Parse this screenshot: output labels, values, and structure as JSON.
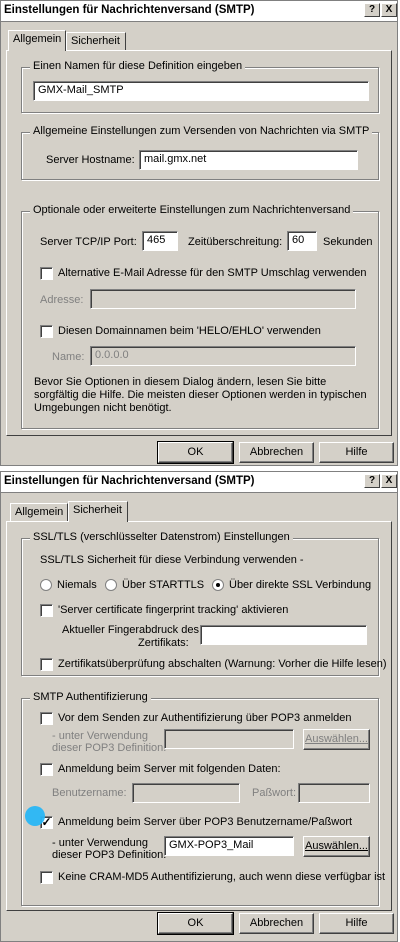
{
  "window_title": "Einstellungen für Nachrichtenversand (SMTP)",
  "title_buttons": {
    "help": "?",
    "close": "X"
  },
  "tabs": {
    "general": "Allgemein",
    "security": "Sicherheit"
  },
  "dialog1": {
    "group_name": {
      "legend": "Einen Namen für diese Definition eingeben",
      "value": "GMX-Mail_SMTP"
    },
    "group_general": {
      "legend": "Allgemeine Einstellungen zum Versenden von Nachrichten via SMTP",
      "host_label": "Server Hostname:",
      "host_value": "mail.gmx.net"
    },
    "group_optional": {
      "legend": "Optionale oder erweiterte Einstellungen zum Nachrichtenversand",
      "port_label": "Server TCP/IP Port:",
      "port_value": "465",
      "timeout_label": "Zeitüberschreitung:",
      "timeout_value": "60",
      "seconds_label": "Sekunden",
      "alt_address_label": "Alternative E-Mail Adresse für den SMTP Umschlag verwenden",
      "address_label": "Adresse:",
      "address_value": "",
      "domain_label": "Diesen Domainnamen beim 'HELO/EHLO' verwenden",
      "name_label": "Name:",
      "name_value": "0.0.0.0",
      "note": "Bevor Sie Optionen in diesem Dialog ändern, lesen Sie bitte sorgfältig die Hilfe. Die meisten dieser Optionen werden in typischen Umgebungen nicht benötigt."
    }
  },
  "dialog2": {
    "group_ssl": {
      "legend": "SSL/TLS (verschlüsselter Datenstrom) Einstellungen",
      "security_label": "SSL/TLS Sicherheit für diese Verbindung verwenden -",
      "radio_never": "Niemals",
      "radio_starttls": "Über STARTTLS",
      "radio_ssl": "Über direkte SSL Verbindung",
      "fingerprint_tracking": "'Server certificate fingerprint tracking' aktivieren",
      "fingerprint_label_1": "Aktueller Fingerabdruck des",
      "fingerprint_label_2": "Zertifikats:",
      "fingerprint_value": "",
      "cert_check_off": "Zertifikatsüberprüfung abschalten (Warnung: Vorher die Hilfe lesen)"
    },
    "group_auth": {
      "legend": "SMTP Authentifizierung",
      "pop3_before": "Vor dem Senden zur Authentifizierung über POP3 anmelden",
      "using_label_1": "- unter Verwendung",
      "using_label_2": "dieser POP3 Definition:",
      "pop3_def_value_disabled": "",
      "select_button": "Auswählen...",
      "login_following": "Anmeldung beim Server mit folgenden Daten:",
      "username_label": "Benutzername:",
      "username_value": "",
      "password_label": "Paßwort:",
      "password_value": "",
      "login_pop3_creds": "Anmeldung beim Server über POP3 Benutzername/Paßwort",
      "pop3_def_value": "GMX-POP3_Mail",
      "no_cram": "Keine CRAM-MD5 Authentifizierung, auch wenn diese verfügbar ist"
    }
  },
  "buttons": {
    "ok": "OK",
    "cancel": "Abbrechen",
    "help": "Hilfe"
  },
  "colors": {
    "face": "#d4d0c8",
    "highlight": "#29b6f6"
  }
}
